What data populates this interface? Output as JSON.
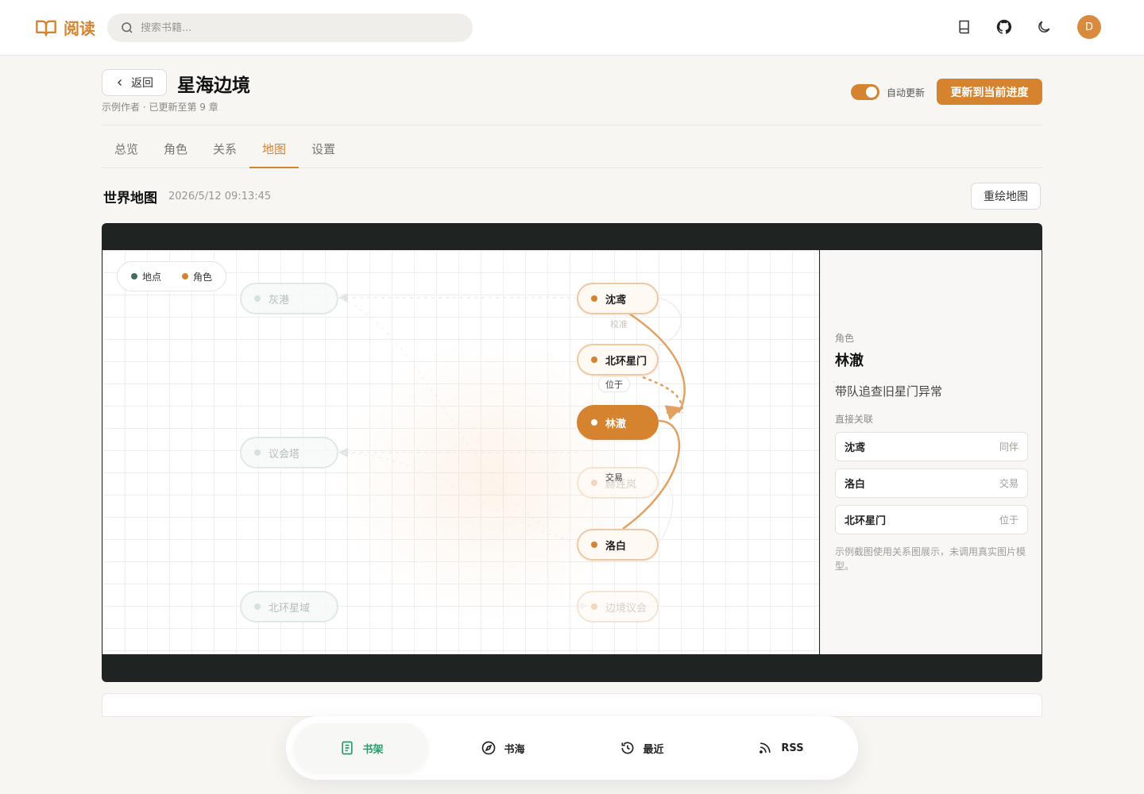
{
  "app": {
    "name": "阅读"
  },
  "search": {
    "placeholder": "搜索书籍..."
  },
  "topbar": {
    "icons": [
      "book-icon",
      "github-icon",
      "moon-icon"
    ],
    "avatar": "D"
  },
  "header": {
    "back_label": "返回",
    "title": "星海边境",
    "meta": "示例作者 · 已更新至第 9 章",
    "auto_update_label": "自动更新",
    "auto_update_on": true,
    "update_button": "更新到当前进度"
  },
  "tabs": [
    {
      "label": "总览",
      "active": false
    },
    {
      "label": "角色",
      "active": false
    },
    {
      "label": "关系",
      "active": false
    },
    {
      "label": "地图",
      "active": true
    },
    {
      "label": "设置",
      "active": false
    }
  ],
  "section": {
    "title": "世界地图",
    "timestamp": "2026/5/12 09:13:45",
    "redraw_button": "重绘地图"
  },
  "map": {
    "legend": {
      "place": "地点",
      "character": "角色"
    },
    "places": [
      "灰港",
      "议会塔",
      "北环星域"
    ],
    "characters": [
      {
        "label": "沈鸢",
        "state": "related"
      },
      {
        "label": "北环星门",
        "state": "related"
      },
      {
        "label": "林澈",
        "state": "selected"
      },
      {
        "label": "赫连岚",
        "state": "faded"
      },
      {
        "label": "洛白",
        "state": "related"
      },
      {
        "label": "边境议会",
        "state": "faded"
      }
    ],
    "edge_labels": {
      "sync": "校准",
      "located": "位于",
      "trade": "交易"
    },
    "colors": {
      "accent": "#d5832e",
      "place": "#d6e2de"
    }
  },
  "detail": {
    "kind": "角色",
    "name": "林澈",
    "description": "带队追查旧星门异常",
    "relations_title": "直接关联",
    "relations": [
      {
        "name": "沈鸢",
        "type": "同伴"
      },
      {
        "name": "洛白",
        "type": "交易"
      },
      {
        "name": "北环星门",
        "type": "位于"
      }
    ],
    "note": "示例截图使用关系图展示，未调用真实图片模型。"
  },
  "bottom_nav": [
    {
      "label": "书架",
      "icon": "bookshelf-icon",
      "active": true
    },
    {
      "label": "书海",
      "icon": "compass-icon",
      "active": false
    },
    {
      "label": "最近",
      "icon": "history-icon",
      "active": false
    },
    {
      "label": "RSS",
      "icon": "rss-icon",
      "active": false
    }
  ]
}
